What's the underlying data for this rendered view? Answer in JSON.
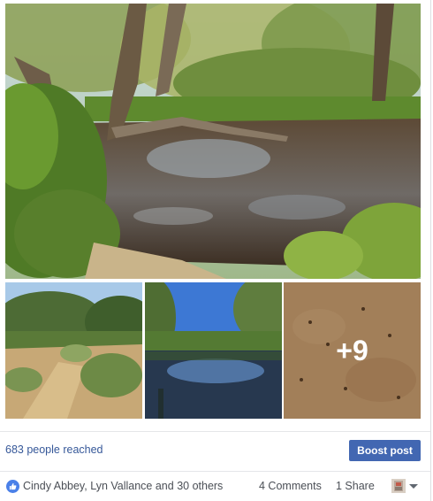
{
  "post": {
    "photos": [
      {
        "description": "creek-with-gum-trees"
      },
      {
        "description": "sandy-path-with-bushes"
      },
      {
        "description": "creek-reflection"
      },
      {
        "description": "sand-with-footprints"
      }
    ],
    "more_photos_label": "+9"
  },
  "stats": {
    "reach_label": "683 people reached",
    "boost_label": "Boost post"
  },
  "footer": {
    "likers_text": "Cindy Abbey, Lyn Vallance and 30 others",
    "comments_label": "4 Comments",
    "shares_label": "1 Share"
  },
  "icons": {
    "like": "thumbs-up-icon",
    "dropdown": "caret-down-icon"
  },
  "colors": {
    "link": "#365899",
    "button": "#4267b2",
    "like_badge": "#4a80e8"
  }
}
